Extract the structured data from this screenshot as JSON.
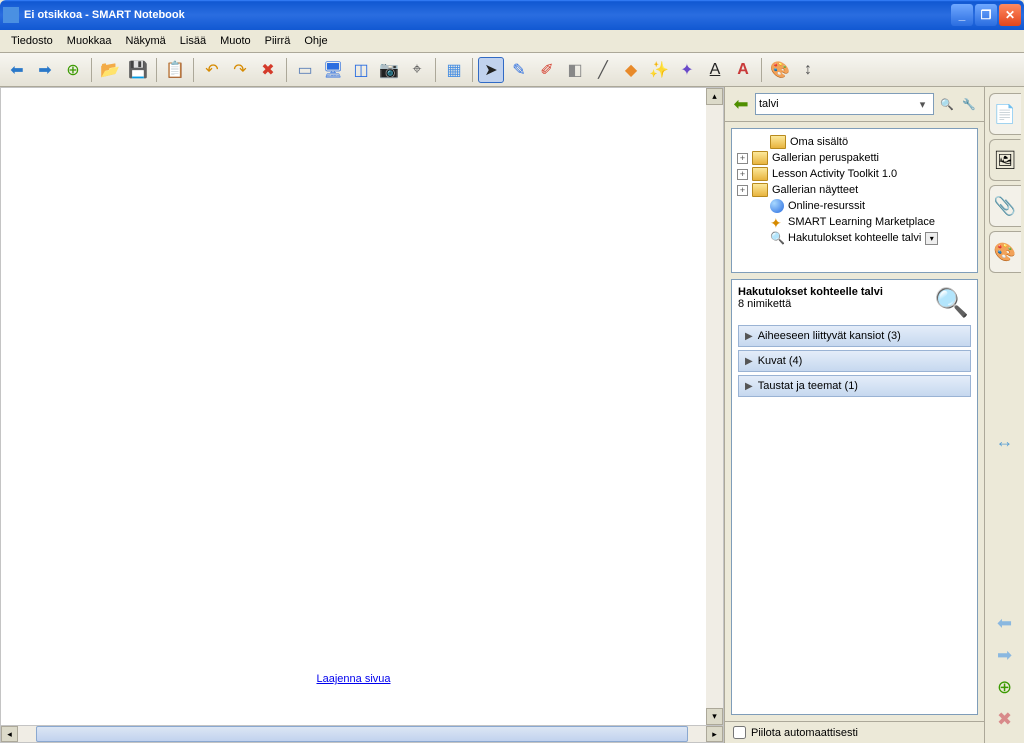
{
  "window": {
    "title": "Ei otsikkoa - SMART Notebook"
  },
  "menu": {
    "items": [
      "Tiedosto",
      "Muokkaa",
      "Näkymä",
      "Lisää",
      "Muoto",
      "Piirrä",
      "Ohje"
    ]
  },
  "canvas": {
    "expand_link": "Laajenna sivua"
  },
  "gallery": {
    "search_value": "talvi",
    "tree": [
      {
        "label": "Oma sisältö",
        "icon": "folder",
        "expandable": false,
        "indent": 1
      },
      {
        "label": "Gallerian peruspaketti",
        "icon": "folder",
        "expandable": true,
        "indent": 0
      },
      {
        "label": "Lesson Activity Toolkit 1.0",
        "icon": "folder",
        "expandable": true,
        "indent": 0
      },
      {
        "label": "Gallerian näytteet",
        "icon": "folder",
        "expandable": true,
        "indent": 0
      },
      {
        "label": "Online-resurssit",
        "icon": "globe",
        "expandable": false,
        "indent": 1
      },
      {
        "label": "SMART Learning Marketplace",
        "icon": "star",
        "expandable": false,
        "indent": 1
      },
      {
        "label": "Hakutulokset kohteelle talvi",
        "icon": "search",
        "expandable": false,
        "indent": 1,
        "dropdown": true
      }
    ],
    "results": {
      "title": "Hakutulokset kohteelle talvi",
      "subtitle": "8 nimikettä",
      "categories": [
        "Aiheeseen liittyvät kansiot (3)",
        "Kuvat (4)",
        "Taustat ja teemat (1)"
      ]
    },
    "hide_auto": "Piilota automaattisesti"
  }
}
